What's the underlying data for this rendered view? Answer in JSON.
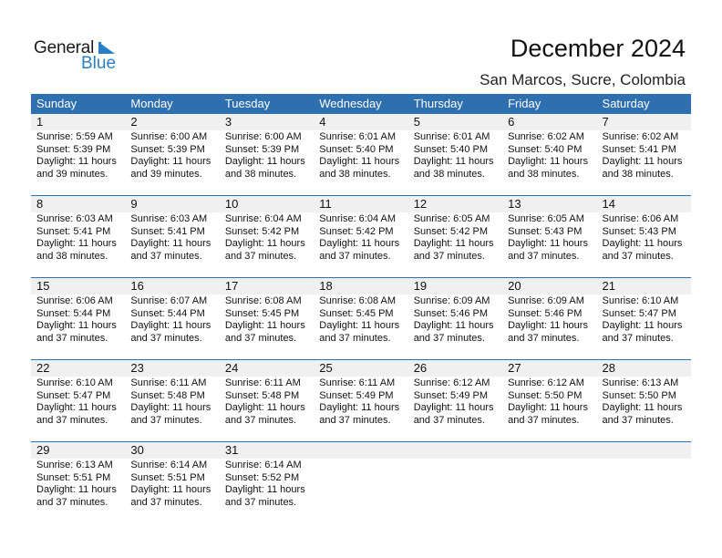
{
  "logo": {
    "text1": "General",
    "text2": "Blue"
  },
  "header": {
    "title": "December 2024",
    "location": "San Marcos, Sucre, Colombia"
  },
  "colors": {
    "accent": "#2e6fb0",
    "day_number_bg": "#f0f0f0",
    "logo_blue": "#2a7fc4"
  },
  "weekdays": [
    "Sunday",
    "Monday",
    "Tuesday",
    "Wednesday",
    "Thursday",
    "Friday",
    "Saturday"
  ],
  "weeks": [
    [
      {
        "day": "1",
        "sunrise": "Sunrise: 5:59 AM",
        "sunset": "Sunset: 5:39 PM",
        "daylight1": "Daylight: 11 hours",
        "daylight2": "and 39 minutes."
      },
      {
        "day": "2",
        "sunrise": "Sunrise: 6:00 AM",
        "sunset": "Sunset: 5:39 PM",
        "daylight1": "Daylight: 11 hours",
        "daylight2": "and 39 minutes."
      },
      {
        "day": "3",
        "sunrise": "Sunrise: 6:00 AM",
        "sunset": "Sunset: 5:39 PM",
        "daylight1": "Daylight: 11 hours",
        "daylight2": "and 38 minutes."
      },
      {
        "day": "4",
        "sunrise": "Sunrise: 6:01 AM",
        "sunset": "Sunset: 5:40 PM",
        "daylight1": "Daylight: 11 hours",
        "daylight2": "and 38 minutes."
      },
      {
        "day": "5",
        "sunrise": "Sunrise: 6:01 AM",
        "sunset": "Sunset: 5:40 PM",
        "daylight1": "Daylight: 11 hours",
        "daylight2": "and 38 minutes."
      },
      {
        "day": "6",
        "sunrise": "Sunrise: 6:02 AM",
        "sunset": "Sunset: 5:40 PM",
        "daylight1": "Daylight: 11 hours",
        "daylight2": "and 38 minutes."
      },
      {
        "day": "7",
        "sunrise": "Sunrise: 6:02 AM",
        "sunset": "Sunset: 5:41 PM",
        "daylight1": "Daylight: 11 hours",
        "daylight2": "and 38 minutes."
      }
    ],
    [
      {
        "day": "8",
        "sunrise": "Sunrise: 6:03 AM",
        "sunset": "Sunset: 5:41 PM",
        "daylight1": "Daylight: 11 hours",
        "daylight2": "and 38 minutes."
      },
      {
        "day": "9",
        "sunrise": "Sunrise: 6:03 AM",
        "sunset": "Sunset: 5:41 PM",
        "daylight1": "Daylight: 11 hours",
        "daylight2": "and 37 minutes."
      },
      {
        "day": "10",
        "sunrise": "Sunrise: 6:04 AM",
        "sunset": "Sunset: 5:42 PM",
        "daylight1": "Daylight: 11 hours",
        "daylight2": "and 37 minutes."
      },
      {
        "day": "11",
        "sunrise": "Sunrise: 6:04 AM",
        "sunset": "Sunset: 5:42 PM",
        "daylight1": "Daylight: 11 hours",
        "daylight2": "and 37 minutes."
      },
      {
        "day": "12",
        "sunrise": "Sunrise: 6:05 AM",
        "sunset": "Sunset: 5:42 PM",
        "daylight1": "Daylight: 11 hours",
        "daylight2": "and 37 minutes."
      },
      {
        "day": "13",
        "sunrise": "Sunrise: 6:05 AM",
        "sunset": "Sunset: 5:43 PM",
        "daylight1": "Daylight: 11 hours",
        "daylight2": "and 37 minutes."
      },
      {
        "day": "14",
        "sunrise": "Sunrise: 6:06 AM",
        "sunset": "Sunset: 5:43 PM",
        "daylight1": "Daylight: 11 hours",
        "daylight2": "and 37 minutes."
      }
    ],
    [
      {
        "day": "15",
        "sunrise": "Sunrise: 6:06 AM",
        "sunset": "Sunset: 5:44 PM",
        "daylight1": "Daylight: 11 hours",
        "daylight2": "and 37 minutes."
      },
      {
        "day": "16",
        "sunrise": "Sunrise: 6:07 AM",
        "sunset": "Sunset: 5:44 PM",
        "daylight1": "Daylight: 11 hours",
        "daylight2": "and 37 minutes."
      },
      {
        "day": "17",
        "sunrise": "Sunrise: 6:08 AM",
        "sunset": "Sunset: 5:45 PM",
        "daylight1": "Daylight: 11 hours",
        "daylight2": "and 37 minutes."
      },
      {
        "day": "18",
        "sunrise": "Sunrise: 6:08 AM",
        "sunset": "Sunset: 5:45 PM",
        "daylight1": "Daylight: 11 hours",
        "daylight2": "and 37 minutes."
      },
      {
        "day": "19",
        "sunrise": "Sunrise: 6:09 AM",
        "sunset": "Sunset: 5:46 PM",
        "daylight1": "Daylight: 11 hours",
        "daylight2": "and 37 minutes."
      },
      {
        "day": "20",
        "sunrise": "Sunrise: 6:09 AM",
        "sunset": "Sunset: 5:46 PM",
        "daylight1": "Daylight: 11 hours",
        "daylight2": "and 37 minutes."
      },
      {
        "day": "21",
        "sunrise": "Sunrise: 6:10 AM",
        "sunset": "Sunset: 5:47 PM",
        "daylight1": "Daylight: 11 hours",
        "daylight2": "and 37 minutes."
      }
    ],
    [
      {
        "day": "22",
        "sunrise": "Sunrise: 6:10 AM",
        "sunset": "Sunset: 5:47 PM",
        "daylight1": "Daylight: 11 hours",
        "daylight2": "and 37 minutes."
      },
      {
        "day": "23",
        "sunrise": "Sunrise: 6:11 AM",
        "sunset": "Sunset: 5:48 PM",
        "daylight1": "Daylight: 11 hours",
        "daylight2": "and 37 minutes."
      },
      {
        "day": "24",
        "sunrise": "Sunrise: 6:11 AM",
        "sunset": "Sunset: 5:48 PM",
        "daylight1": "Daylight: 11 hours",
        "daylight2": "and 37 minutes."
      },
      {
        "day": "25",
        "sunrise": "Sunrise: 6:11 AM",
        "sunset": "Sunset: 5:49 PM",
        "daylight1": "Daylight: 11 hours",
        "daylight2": "and 37 minutes."
      },
      {
        "day": "26",
        "sunrise": "Sunrise: 6:12 AM",
        "sunset": "Sunset: 5:49 PM",
        "daylight1": "Daylight: 11 hours",
        "daylight2": "and 37 minutes."
      },
      {
        "day": "27",
        "sunrise": "Sunrise: 6:12 AM",
        "sunset": "Sunset: 5:50 PM",
        "daylight1": "Daylight: 11 hours",
        "daylight2": "and 37 minutes."
      },
      {
        "day": "28",
        "sunrise": "Sunrise: 6:13 AM",
        "sunset": "Sunset: 5:50 PM",
        "daylight1": "Daylight: 11 hours",
        "daylight2": "and 37 minutes."
      }
    ],
    [
      {
        "day": "29",
        "sunrise": "Sunrise: 6:13 AM",
        "sunset": "Sunset: 5:51 PM",
        "daylight1": "Daylight: 11 hours",
        "daylight2": "and 37 minutes."
      },
      {
        "day": "30",
        "sunrise": "Sunrise: 6:14 AM",
        "sunset": "Sunset: 5:51 PM",
        "daylight1": "Daylight: 11 hours",
        "daylight2": "and 37 minutes."
      },
      {
        "day": "31",
        "sunrise": "Sunrise: 6:14 AM",
        "sunset": "Sunset: 5:52 PM",
        "daylight1": "Daylight: 11 hours",
        "daylight2": "and 37 minutes."
      },
      {
        "day": "",
        "sunrise": "",
        "sunset": "",
        "daylight1": "",
        "daylight2": ""
      },
      {
        "day": "",
        "sunrise": "",
        "sunset": "",
        "daylight1": "",
        "daylight2": ""
      },
      {
        "day": "",
        "sunrise": "",
        "sunset": "",
        "daylight1": "",
        "daylight2": ""
      },
      {
        "day": "",
        "sunrise": "",
        "sunset": "",
        "daylight1": "",
        "daylight2": ""
      }
    ]
  ]
}
